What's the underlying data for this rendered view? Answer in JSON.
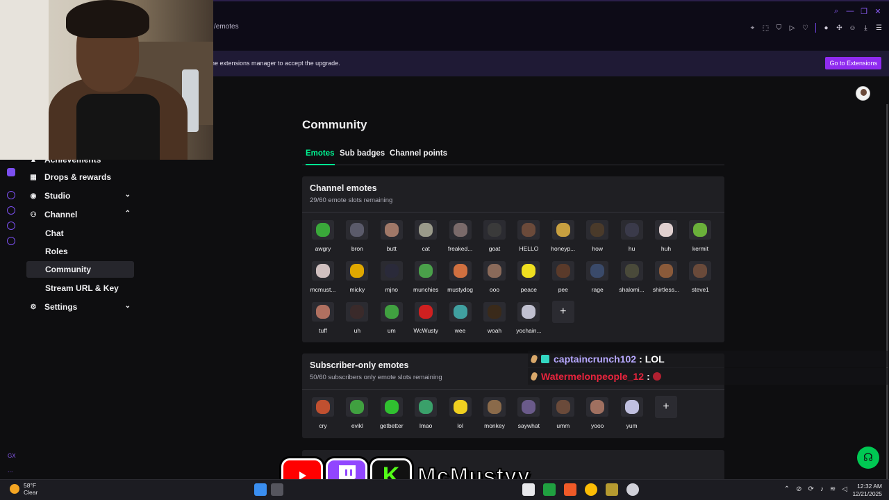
{
  "browser": {
    "url": "/emotes",
    "banner_text": "he extensions manager to accept the upgrade.",
    "banner_button": "Go to Extensions"
  },
  "sidebar": {
    "items": [
      {
        "label": "Achievements",
        "icon": "trophy-icon"
      },
      {
        "label": "Drops & rewards",
        "icon": "gift-icon"
      },
      {
        "label": "Studio",
        "icon": "studio-icon",
        "chevron": "down"
      },
      {
        "label": "Channel",
        "icon": "channel-icon",
        "chevron": "up"
      },
      {
        "label": "Chat",
        "sub": true
      },
      {
        "label": "Roles",
        "sub": true
      },
      {
        "label": "Community",
        "sub": true,
        "active": true
      },
      {
        "label": "Stream URL & Key",
        "sub": true
      },
      {
        "label": "Settings",
        "icon": "gear-icon",
        "chevron": "down"
      }
    ],
    "gx_label": "GX",
    "more_label": "..."
  },
  "page": {
    "title": "Community",
    "tabs": [
      "Emotes",
      "Sub badges",
      "Channel points"
    ],
    "active_tab": "Emotes"
  },
  "channel_emotes": {
    "title": "Channel emotes",
    "subtitle": "29/60 emote slots remaining",
    "emotes": [
      {
        "label": "awgry",
        "color": "#3aa83a"
      },
      {
        "label": "bron",
        "color": "#5a5a6a"
      },
      {
        "label": "butt",
        "color": "#a07868"
      },
      {
        "label": "cat",
        "color": "#9a9a8a"
      },
      {
        "label": "freaked...",
        "color": "#7a6a6a"
      },
      {
        "label": "goat",
        "color": "#3a3a3a"
      },
      {
        "label": "HELLO",
        "color": "#6b4a3a"
      },
      {
        "label": "honeyp...",
        "color": "#c8a040"
      },
      {
        "label": "how",
        "color": "#4a3a2a"
      },
      {
        "label": "hu",
        "color": "#3a3a4a"
      },
      {
        "label": "huh",
        "color": "#e0d0d0"
      },
      {
        "label": "kermit",
        "color": "#6ab03a"
      },
      {
        "label": "mcmust...",
        "color": "#d0c0c0"
      },
      {
        "label": "micky",
        "color": "#e0a800"
      },
      {
        "label": "mjno",
        "color": "#2a2a3a"
      },
      {
        "label": "munchies",
        "color": "#4aa04a"
      },
      {
        "label": "mustydog",
        "color": "#d07040"
      },
      {
        "label": "ooo",
        "color": "#8a6a5a"
      },
      {
        "label": "peace",
        "color": "#f0e020"
      },
      {
        "label": "pee",
        "color": "#5a3a2a"
      },
      {
        "label": "rage",
        "color": "#3a4a6a"
      },
      {
        "label": "shalomi...",
        "color": "#4a4a3a"
      },
      {
        "label": "shirtless...",
        "color": "#8a5a3a"
      },
      {
        "label": "steve1",
        "color": "#6a4a3a"
      },
      {
        "label": "tuff",
        "color": "#b07060"
      },
      {
        "label": "uh",
        "color": "#3a2a2a"
      },
      {
        "label": "um",
        "color": "#40a040"
      },
      {
        "label": "WcWusty",
        "color": "#d02020"
      },
      {
        "label": "wee",
        "color": "#40a0a0"
      },
      {
        "label": "woah",
        "color": "#3a2a1a"
      },
      {
        "label": "yochain...",
        "color": "#c0c0d0"
      }
    ]
  },
  "subscriber_emotes": {
    "title": "Subscriber-only emotes",
    "subtitle": "50/60 subscribers only emote slots remaining",
    "emotes": [
      {
        "label": "cry",
        "color": "#c05030"
      },
      {
        "label": "evikl",
        "color": "#40a040"
      },
      {
        "label": "getbetter",
        "color": "#30c030"
      },
      {
        "label": "lmao",
        "color": "#3aa06a"
      },
      {
        "label": "lol",
        "color": "#f0d020"
      },
      {
        "label": "monkey",
        "color": "#8a6a4a"
      },
      {
        "label": "saywhat",
        "color": "#6a5a8a"
      },
      {
        "label": "umm",
        "color": "#6a4a3a"
      },
      {
        "label": "yooo",
        "color": "#a07060"
      },
      {
        "label": "yum",
        "color": "#c0c0e0"
      }
    ]
  },
  "chat_overlay": [
    {
      "user": "captaincrunch102",
      "user_color": "#b7a8ff",
      "message": "LOL"
    },
    {
      "user": "Watermelonpeople_12",
      "user_color": "#e8243d",
      "message": ""
    }
  ],
  "branding": {
    "name": "McMustyy",
    "kick_letter": "K"
  },
  "taskbar": {
    "temp": "58°F",
    "condition": "Clear",
    "time": "12:32 AM",
    "date": "12/21/2025"
  },
  "colors": {
    "accent": "#00f593",
    "purple": "#8f2bf0",
    "help": "#00c853"
  }
}
